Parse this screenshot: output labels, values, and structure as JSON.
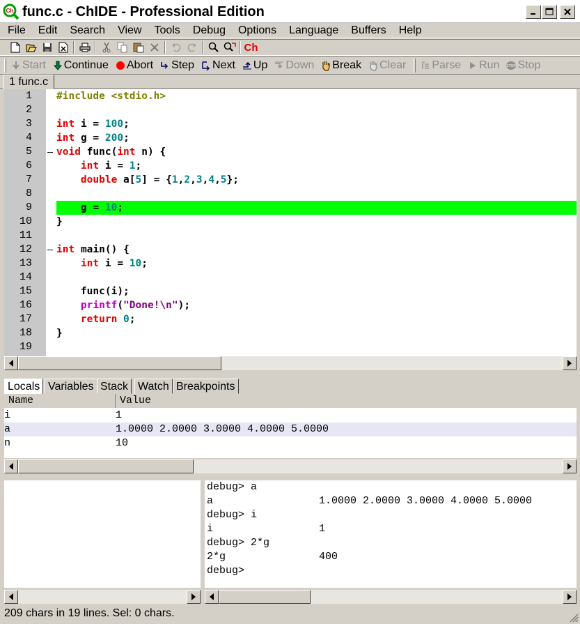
{
  "window": {
    "title": "func.c - ChIDE - Professional Edition",
    "app_icon_text": "Ch"
  },
  "menu": [
    "File",
    "Edit",
    "Search",
    "View",
    "Tools",
    "Debug",
    "Options",
    "Language",
    "Buffers",
    "Help"
  ],
  "toolbar": {
    "icons": [
      "new-file-icon",
      "open-file-icon",
      "save-icon",
      "close-file-icon",
      "print-icon",
      "cut-icon",
      "copy-icon",
      "paste-icon",
      "delete-icon",
      "undo-icon",
      "redo-icon",
      "find-icon",
      "replace-icon",
      "ch-icon"
    ],
    "ch_label": "Ch"
  },
  "debug_toolbar": {
    "start": "Start",
    "continue": "Continue",
    "abort": "Abort",
    "step": "Step",
    "next": "Next",
    "up": "Up",
    "down": "Down",
    "break": "Break",
    "clear": "Clear",
    "parse": "Parse",
    "run": "Run",
    "stop": "Stop"
  },
  "file_tab": "1 func.c",
  "editor": {
    "current_line": 9,
    "lines": [
      {
        "n": "1",
        "text": "#include <stdio.h>"
      },
      {
        "n": "2",
        "text": ""
      },
      {
        "n": "3",
        "text": "int i = 100;"
      },
      {
        "n": "4",
        "text": "int g = 200;"
      },
      {
        "n": "5",
        "text": "void func(int n) {"
      },
      {
        "n": "6",
        "text": "    int i = 1;"
      },
      {
        "n": "7",
        "text": "    double a[5] = {1,2,3,4,5};"
      },
      {
        "n": "8",
        "text": ""
      },
      {
        "n": "9",
        "text": "    g = 10;"
      },
      {
        "n": "10",
        "text": "}"
      },
      {
        "n": "11",
        "text": ""
      },
      {
        "n": "12",
        "text": "int main() {"
      },
      {
        "n": "13",
        "text": "    int i = 10;"
      },
      {
        "n": "14",
        "text": ""
      },
      {
        "n": "15",
        "text": "    func(i);"
      },
      {
        "n": "16",
        "text": "    printf(\"Done!\\n\");"
      },
      {
        "n": "17",
        "text": "    return 0;"
      },
      {
        "n": "18",
        "text": "}"
      },
      {
        "n": "19",
        "text": ""
      }
    ]
  },
  "debug_tabs": [
    "Locals",
    "Variables",
    "Stack",
    "Watch",
    "Breakpoints"
  ],
  "locals": {
    "headers": [
      "Name",
      "Value"
    ],
    "rows": [
      {
        "name": "i",
        "value": "1"
      },
      {
        "name": "a",
        "value": "1.0000 2.0000 3.0000 4.0000 5.0000"
      },
      {
        "name": "n",
        "value": "10"
      }
    ]
  },
  "console": {
    "lines": [
      {
        "text": "debug> a",
        "value": ""
      },
      {
        "text": "a",
        "value": "1.0000 2.0000 3.0000 4.0000 5.0000"
      },
      {
        "text": "debug> i",
        "value": ""
      },
      {
        "text": "i",
        "value": "1"
      },
      {
        "text": "debug> 2*g",
        "value": ""
      },
      {
        "text": "2*g",
        "value": "400"
      },
      {
        "text": "debug>",
        "value": ""
      }
    ]
  },
  "status": "209 chars in 19 lines. Sel: 0 chars.",
  "colors": {
    "highlight": "#00ff00",
    "keyword": "#e00000",
    "number": "#008080",
    "preprocessor": "#808000",
    "string": "#800080",
    "function": "#c000c0"
  }
}
